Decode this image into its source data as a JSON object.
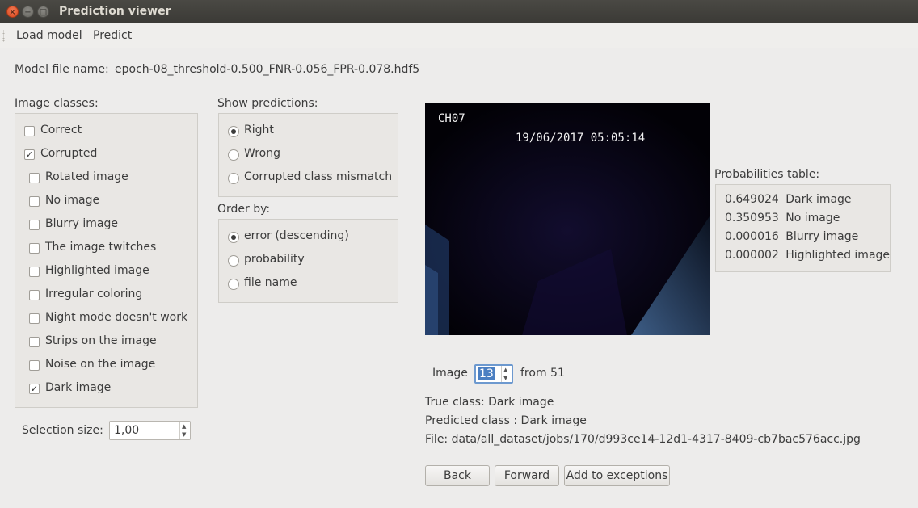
{
  "window": {
    "title": "Prediction viewer"
  },
  "menu": {
    "items": [
      "Load model",
      "Predict"
    ]
  },
  "model": {
    "label": "Model file name:",
    "value": "epoch-08_threshold-0.500_FNR-0.056_FPR-0.078.hdf5"
  },
  "image_classes": {
    "label": "Image classes:",
    "items": [
      {
        "label": "Correct",
        "checked": false
      },
      {
        "label": "Corrupted",
        "checked": true
      },
      {
        "label": "Rotated image",
        "checked": false
      },
      {
        "label": "No image",
        "checked": false
      },
      {
        "label": "Blurry image",
        "checked": false
      },
      {
        "label": "The image twitches",
        "checked": false
      },
      {
        "label": "Highlighted image",
        "checked": false
      },
      {
        "label": "Irregular coloring",
        "checked": false
      },
      {
        "label": "Night mode doesn't work",
        "checked": false
      },
      {
        "label": "Strips on the image",
        "checked": false
      },
      {
        "label": "Noise on the image",
        "checked": false
      },
      {
        "label": "Dark image",
        "checked": true
      }
    ]
  },
  "show_predictions": {
    "label": "Show predictions:",
    "options": [
      "Right",
      "Wrong",
      "Corrupted class mismatch"
    ],
    "selected": 0
  },
  "order_by": {
    "label": "Order by:",
    "options": [
      "error (descending)",
      "probability",
      "file name"
    ],
    "selected": 0
  },
  "selection_size": {
    "label": "Selection size:",
    "value": "1,00"
  },
  "image_overlay": {
    "channel": "CH07",
    "timestamp": "19/06/2017 05:05:14"
  },
  "probabilities": {
    "label": "Probabilities table:",
    "rows": [
      {
        "value": "0.649024",
        "name": "Dark image"
      },
      {
        "value": "0.350953",
        "name": "No image"
      },
      {
        "value": "0.000016",
        "name": "Blurry image"
      },
      {
        "value": "0.000002",
        "name": "Highlighted image"
      }
    ]
  },
  "navigator": {
    "label": "Image",
    "value": "13",
    "suffix": "from 51"
  },
  "info": {
    "true_class": "True class: Dark image",
    "predicted_class": "Predicted class : Dark image",
    "file": "File: data/all_dataset/jobs/170/d993ce14-12d1-4317-8409-cb7bac576acc.jpg"
  },
  "buttons": {
    "back": "Back",
    "forward": "Forward",
    "add": "Add to exceptions"
  },
  "icons": {
    "close": "close-icon",
    "minimize": "minimize-icon",
    "maximize": "maximize-icon"
  }
}
